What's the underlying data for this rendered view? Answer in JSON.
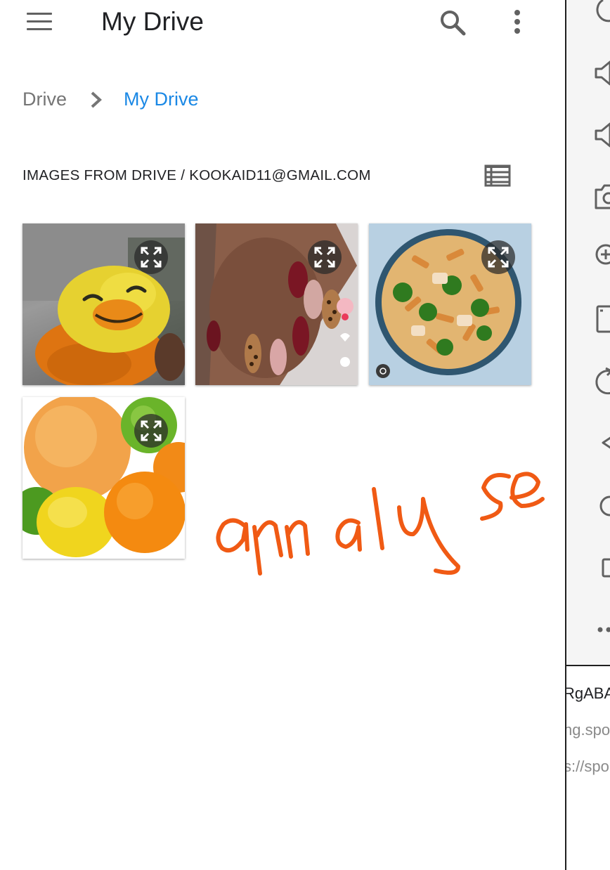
{
  "app_bar": {
    "title": "My Drive",
    "menu_icon": "menu-icon",
    "search_icon": "search-icon",
    "more_icon": "more-vert-icon"
  },
  "breadcrumb": {
    "root": "Drive",
    "separator_icon": "chevron-right-icon",
    "current": "My Drive"
  },
  "section": {
    "title": "IMAGES FROM DRIVE / KOOKAID11@GMAIL.COM",
    "view_toggle_icon": "list-view-icon"
  },
  "images": [
    {
      "subject": "duck plush toy",
      "action_icon": "expand-icon"
    },
    {
      "subject": "painted nails",
      "action_icon": "expand-icon"
    },
    {
      "subject": "penne pasta with broccoli",
      "action_icon": "expand-icon"
    },
    {
      "subject": "citrus fruits",
      "action_icon": "expand-icon"
    }
  ],
  "annotation": {
    "handwritten_text": "analyse",
    "color": "#f05a14"
  },
  "side_panel": {
    "icons": [
      "power-icon",
      "volume-up-icon",
      "volume-down-icon",
      "camera-icon",
      "zoom-in-icon",
      "tablet-icon",
      "rotate-icon",
      "back-icon",
      "home-icon",
      "overview-icon",
      "more-icon"
    ],
    "clipped_text": [
      "RgABA",
      "ng.spo",
      "s://spo"
    ]
  },
  "colors": {
    "accent": "#1a88e5",
    "icon_gray": "#616161",
    "text": "#202124"
  }
}
